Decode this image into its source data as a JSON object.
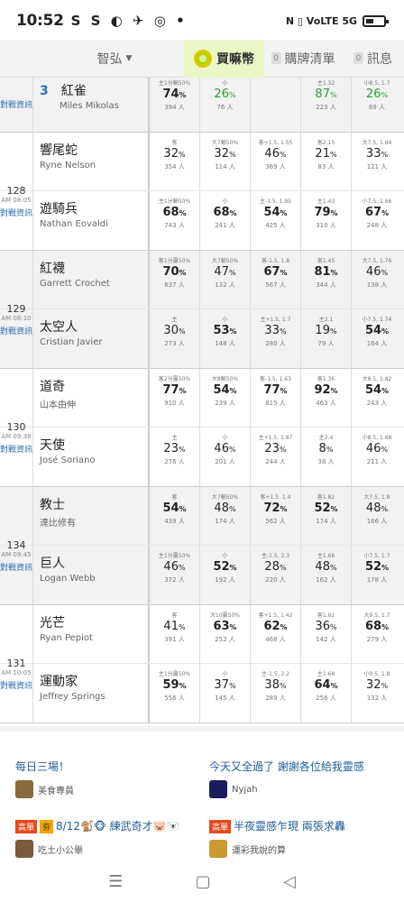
{
  "status": {
    "time": "10:52",
    "apps": "S S ◐ ✈ ◎ •",
    "sys": "N ▯ VoLTE 5G"
  },
  "tabs": {
    "dropdown": "智弘",
    "coin": "買嘛幣",
    "cart_count": "0",
    "cart": "購牌清單",
    "msg_count": "0",
    "msg": "訊息"
  },
  "games": [
    {
      "num": "",
      "time": "",
      "dz": "對戰資訊",
      "rows": [
        {
          "zh": "紅雀",
          "en": "Miles Mikolas",
          "rank": "3",
          "odds": [
            {
              "t": "主1分輸50%",
              "p": "74",
              "c": "394 人",
              "s": "b"
            },
            {
              "t": "小",
              "p": "26",
              "c": "76 人",
              "s": "g"
            },
            {
              "t": "",
              "p": "",
              "c": "",
              "s": ""
            },
            {
              "t": "主1.32",
              "p": "87",
              "c": "223 人",
              "s": "g"
            },
            {
              "t": "小8.5, 1.7",
              "p": "26",
              "c": "69 人",
              "s": "g"
            }
          ]
        }
      ]
    },
    {
      "num": "128",
      "time": "AM 08:05",
      "dz": "對戰資訊",
      "rows": [
        {
          "zh": "響尾蛇",
          "en": "Ryne Nelson",
          "rank": "",
          "odds": [
            {
              "t": "客",
              "p": "32",
              "c": "354 人",
              "s": ""
            },
            {
              "t": "大7輸50%",
              "p": "32",
              "c": "114 人",
              "s": ""
            },
            {
              "t": "客+1.5, 1.55",
              "p": "46",
              "c": "369 人",
              "s": ""
            },
            {
              "t": "客2.15",
              "p": "21",
              "c": "83 人",
              "s": ""
            },
            {
              "t": "大7.5, 1.84",
              "p": "33",
              "c": "121 人",
              "s": ""
            }
          ]
        },
        {
          "zh": "遊騎兵",
          "en": "Nathan Eovaldi",
          "rank": "",
          "odds": [
            {
              "t": "主1分輸50%",
              "p": "68",
              "c": "743 人",
              "s": "b"
            },
            {
              "t": "小",
              "p": "68",
              "c": "241 人",
              "s": "b"
            },
            {
              "t": "主-1.5, 1.95",
              "p": "54",
              "c": "425 人",
              "s": "b"
            },
            {
              "t": "主1.43",
              "p": "79",
              "c": "310 人",
              "s": "b"
            },
            {
              "t": "小7.5, 1.66",
              "p": "67",
              "c": "248 人",
              "s": "b"
            }
          ]
        }
      ]
    },
    {
      "num": "129",
      "time": "AM 08:10",
      "dz": "對戰資訊",
      "rows": [
        {
          "zh": "紅襪",
          "en": "Garrett Crochet",
          "rank": "",
          "odds": [
            {
              "t": "客1分贏50%",
              "p": "70",
              "c": "637 人",
              "s": "b"
            },
            {
              "t": "大7輸50%",
              "p": "47",
              "c": "132 人",
              "s": ""
            },
            {
              "t": "客-1.5, 1.8",
              "p": "67",
              "c": "567 人",
              "s": "b"
            },
            {
              "t": "客1.45",
              "p": "81",
              "c": "344 人",
              "s": "b"
            },
            {
              "t": "大7.5, 1.76",
              "p": "46",
              "c": "138 人",
              "s": ""
            }
          ]
        },
        {
          "zh": "太空人",
          "en": "Cristian Javier",
          "rank": "",
          "odds": [
            {
              "t": "主",
              "p": "30",
              "c": "273 人",
              "s": ""
            },
            {
              "t": "小",
              "p": "53",
              "c": "148 人",
              "s": "b"
            },
            {
              "t": "主+1.5, 1.7",
              "p": "33",
              "c": "280 人",
              "s": ""
            },
            {
              "t": "主2.1",
              "p": "19",
              "c": "79 人",
              "s": ""
            },
            {
              "t": "小7.5, 1.74",
              "p": "54",
              "c": "164 人",
              "s": "b"
            }
          ]
        }
      ]
    },
    {
      "num": "130",
      "time": "AM 09:38",
      "dz": "對戰資訊",
      "rows": [
        {
          "zh": "道奇",
          "en": "山本由伸",
          "rank": "",
          "odds": [
            {
              "t": "客2分贏50%",
              "p": "77",
              "c": "910 人",
              "s": "b"
            },
            {
              "t": "大8輸50%",
              "p": "54",
              "c": "239 人",
              "s": "b"
            },
            {
              "t": "客-1.5, 1.63",
              "p": "77",
              "c": "815 人",
              "s": "b"
            },
            {
              "t": "客1.36",
              "p": "92",
              "c": "463 人",
              "s": "b"
            },
            {
              "t": "大8.5, 1.82",
              "p": "54",
              "c": "243 人",
              "s": "b"
            }
          ]
        },
        {
          "zh": "天使",
          "en": "José Soriano",
          "rank": "",
          "odds": [
            {
              "t": "主",
              "p": "23",
              "c": "276 人",
              "s": ""
            },
            {
              "t": "小",
              "p": "46",
              "c": "201 人",
              "s": ""
            },
            {
              "t": "主+1.5, 1.87",
              "p": "23",
              "c": "244 人",
              "s": ""
            },
            {
              "t": "主2.4",
              "p": "8",
              "c": "38 人",
              "s": ""
            },
            {
              "t": "小8.5, 1.68",
              "p": "46",
              "c": "211 人",
              "s": ""
            }
          ]
        }
      ]
    },
    {
      "num": "134",
      "time": "AM 09:45",
      "dz": "對戰資訊",
      "rows": [
        {
          "zh": "教士",
          "en": "達比修有",
          "rank": "",
          "odds": [
            {
              "t": "客",
              "p": "54",
              "c": "439 人",
              "s": "b"
            },
            {
              "t": "大7輸50%",
              "p": "48",
              "c": "174 人",
              "s": ""
            },
            {
              "t": "客+1.5, 1.4",
              "p": "72",
              "c": "562 人",
              "s": "b"
            },
            {
              "t": "客1.82",
              "p": "52",
              "c": "174 人",
              "s": "b"
            },
            {
              "t": "大7.5, 1.8",
              "p": "48",
              "c": "166 人",
              "s": ""
            }
          ]
        },
        {
          "zh": "巨人",
          "en": "Logan Webb",
          "rank": "",
          "odds": [
            {
              "t": "主1分贏50%",
              "p": "46",
              "c": "372 人",
              "s": ""
            },
            {
              "t": "小",
              "p": "52",
              "c": "192 人",
              "s": "b"
            },
            {
              "t": "主-1.5, 2.3",
              "p": "28",
              "c": "220 人",
              "s": ""
            },
            {
              "t": "主1.68",
              "p": "48",
              "c": "162 人",
              "s": ""
            },
            {
              "t": "小7.5, 1.7",
              "p": "52",
              "c": "178 人",
              "s": "b"
            }
          ]
        }
      ]
    },
    {
      "num": "131",
      "time": "AM 10:05",
      "dz": "對戰資訊",
      "rows": [
        {
          "zh": "光芒",
          "en": "Ryan Pepiot",
          "rank": "",
          "odds": [
            {
              "t": "客",
              "p": "41",
              "c": "391 人",
              "s": ""
            },
            {
              "t": "大10贏50%",
              "p": "63",
              "c": "252 人",
              "s": "b"
            },
            {
              "t": "客+1.5, 1.42",
              "p": "62",
              "c": "468 人",
              "s": "b"
            },
            {
              "t": "客1.82",
              "p": "36",
              "c": "142 人",
              "s": ""
            },
            {
              "t": "大9.5, 1.7",
              "p": "68",
              "c": "279 人",
              "s": "b"
            }
          ]
        },
        {
          "zh": "運動家",
          "en": "Jeffrey Springs",
          "rank": "",
          "odds": [
            {
              "t": "主1分贏50%",
              "p": "59",
              "c": "556 人",
              "s": "b"
            },
            {
              "t": "小",
              "p": "37",
              "c": "145 人",
              "s": ""
            },
            {
              "t": "主-1.5, 2.2",
              "p": "38",
              "c": "289 人",
              "s": ""
            },
            {
              "t": "主1.68",
              "p": "64",
              "c": "256 人",
              "s": "b"
            },
            {
              "t": "小9.5, 1.8",
              "p": "32",
              "c": "132 人",
              "s": ""
            }
          ]
        }
      ]
    }
  ],
  "posts": [
    {
      "title": "每日三場！",
      "tag": "",
      "tag2": "",
      "author": "美食專員",
      "avatar_color": "#8a6b3d"
    },
    {
      "title": "今天又全過了 謝謝各位給我靈感",
      "tag": "",
      "tag2": "",
      "author": "Nyjah",
      "avatar_color": "#1b1b5e"
    },
    {
      "title": "8/12🐒🐵 練武奇才🐷🐻‍❄️",
      "tag": "高單",
      "tag2": "夯",
      "author": "吃土小公舉",
      "avatar_color": "#7a5a3a"
    },
    {
      "title": "半夜靈感乍現 兩張求轟",
      "tag": "高單",
      "tag2": "",
      "author": "運彩我說的算",
      "avatar_color": "#c99a2e"
    }
  ],
  "nav": {
    "menu": "☰",
    "home": "▢",
    "back": "◁"
  }
}
